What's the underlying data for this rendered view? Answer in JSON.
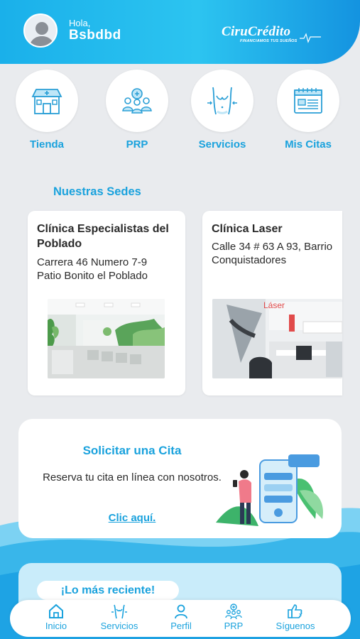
{
  "header": {
    "greeting": "Hola,",
    "username": "Bsbdbd",
    "brand_name": "CiruCrédito",
    "brand_tagline": "FINANCIAMOS TUS SUEÑOS"
  },
  "quick_actions": [
    {
      "label": "Tienda",
      "icon": "store-icon"
    },
    {
      "label": "PRP",
      "icon": "group-medical-icon"
    },
    {
      "label": "Servicios",
      "icon": "body-contour-icon"
    },
    {
      "label": "Mis Citas",
      "icon": "calendar-icon"
    }
  ],
  "sedes": {
    "title": "Nuestras Sedes",
    "items": [
      {
        "name": "Clínica Especialistas del Poblado",
        "address": "Carrera 46 Numero 7-9 Patio Bonito el Poblado"
      },
      {
        "name": "Clínica Laser",
        "address": "Calle 34 # 63 A 93, Barrio Conquistadores"
      }
    ],
    "photo_overlay_text": "Láser"
  },
  "cita": {
    "title": "Solicitar una Cita",
    "text": "Reserva tu cita en línea con nosotros.",
    "link": "Clic aquí."
  },
  "reciente": {
    "title": "¡Lo más reciente!"
  },
  "tabbar": [
    {
      "label": "Inicio",
      "icon": "home-icon"
    },
    {
      "label": "Servicios",
      "icon": "services-icon"
    },
    {
      "label": "Perfil",
      "icon": "user-icon"
    },
    {
      "label": "PRP",
      "icon": "group-medical-icon"
    },
    {
      "label": "Síguenos",
      "icon": "thumbs-up-icon"
    }
  ],
  "colors": {
    "accent": "#1aa2dd",
    "header": "#1ab0ea",
    "background": "#e9ebee"
  }
}
